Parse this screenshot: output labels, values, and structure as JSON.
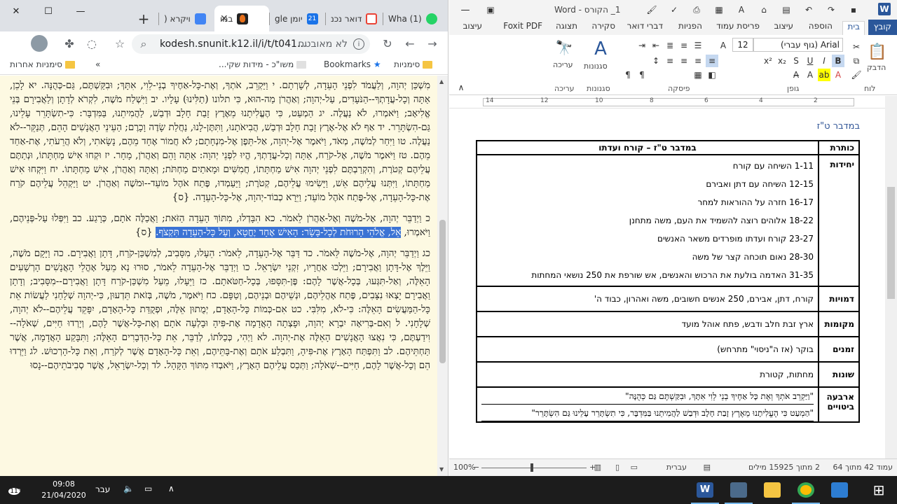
{
  "chrome": {
    "tabs": [
      {
        "label": "במו",
        "active": true,
        "color": "#d93025"
      },
      {
        "label": "ויקרא (",
        "color": "#4285f4"
      },
      {
        "label": "יומן gle",
        "color": "#1a73e8"
      },
      {
        "label": "דואר נכנ",
        "color": "#ea4335"
      },
      {
        "label": "(1) Wha",
        "color": "#25d366"
      }
    ],
    "new_tab_symbol": "+",
    "url": "kodesh.snunit.k12.il/i/t/t041...",
    "security_label": "לא מאובטח",
    "bookmarks": {
      "other": "סימניות אחרות",
      "item1": "משו\"כ - מידות שקי...",
      "item2": "Bookmarks",
      "item3": "סימניות",
      "more": "»"
    },
    "text": {
      "para1": "מִשְׁכַּן יְהוָה, וְלַעֲמֹד לִפְנֵי הָעֵדָה, לְשָׁרְתָם. י וַיַּקְרֵב, אֹתְךָ, וְאֶת-כָּל-אַחֶיךָ בְנֵי-לֵוִי, אִתָּךְ; וּבִקַּשְׁתֶּם, גַּם-כְּהֻנָּה. יא לָכֵן, אַתָּה וְכָל-עֲדָתְךָ--הַנֹּעָדִים, עַל-יְהוָה; וְאַהֲרֹן מַה-הוּא, כִּי תלונו (תַלִּינוּ) עָלָיו. יב וַיִּשְׁלַח מֹשֶׁה, לִקְרֹא לְדָתָן וְלַאֲבִירָם בְּנֵי אֱלִיאָב; וַיֹּאמְרוּ, לֹא נַעֲלֶה. יג הַמְעַט, כִּי הֶעֱלִיתָנוּ מֵאֶרֶץ זָבַת חָלָב וּדְבַשׁ, לַהֲמִיתֵנוּ, בַּמִּדְבָּר: כִּי-תִשְׂתָּרֵר עָלֵינוּ, גַּם-הִשְׂתָּרֵר. יד אַף לֹא אֶל-אֶרֶץ זָבַת חָלָב וּדְבַשׁ, הֲבִיאֹתָנוּ, וַתִּתֶּן-לָנוּ, נַחֲלַת שָׂדֶה וָכָרֶם; הַעֵינֵי הָאֲנָשִׁים הָהֵם, תְּנַקֵּר--לֹא נַעֲלֶה. טו וַיִּחַר לְמֹשֶׁה, מְאֹד, וַיֹּאמֶר אֶל-יְהוָה, אַל-תֵּפֶן אֶל-מִנְחָתָם; לֹא חֲמוֹר אֶחָד מֵהֶם, נָשָׂאתִי, וְלֹא הֲרֵעֹתִי, אֶת-אַחַד מֵהֶם. טז וַיֹּאמֶר מֹשֶׁה, אֶל-קֹרַח, אַתָּה וְכָל-עֲדָתְךָ, הֱיוּ לִפְנֵי יְהוָה: אַתָּה וָהֵם וְאַהֲרֹן, מָחָר. יז וּקְחוּ אִישׁ מַחְתָּתוֹ, וּנְתַתֶּם עֲלֵיהֶם קְטֹרֶת, וְהִקְרַבְתֶּם לִפְנֵי יְהוָה אִישׁ מַחְתָּתוֹ, חֲמִשִּׁים וּמָאתַיִם מַחְתֹּת; וְאַתָּה וְאַהֲרֹן, אִישׁ מַחְתָּתוֹ. יח וַיִּקְחוּ אִישׁ מַחְתָּתוֹ, וַיִּתְּנוּ עֲלֵיהֶם אֵשׁ, וַיָּשִׂימוּ עֲלֵיהֶם, קְטֹרֶת; וַיַּעַמְדוּ, פֶּתַח אֹהֶל מוֹעֵד--וּמֹשֶׁה וְאַהֲרֹן. יט וַיַּקְהֵל עֲלֵיהֶם קֹרַח אֶת-כָּל-הָעֵדָה, אֶל-פֶּתַח אֹהֶל מוֹעֵד; וַיֵּרָא כְבוֹד-יְהוָה, אֶל-כָּל-הָעֵדָה. {ס}",
      "para2_a": "כ וַיְדַבֵּר יְהוָה, אֶל-מֹשֶׁה וְאֶל-אַהֲרֹן לֵאמֹר. כא הִבָּדְלוּ, מִתּוֹךְ הָעֵדָה הַזֹּאת; וַאֲכַלֶּה אֹתָם, כְּרָגַע. כב וַיִּפְּלוּ עַל-פְּנֵיהֶם, וַיֹּאמְרוּ,",
      "para2_hl": "אֵל, אֱלֹהֵי הָרוּחֹת לְכָל-בָּשָׂר: הָאִישׁ אֶחָד יֶחֱטָא, וְעַל כָּל-הָעֵדָה תִּקְצֹף.",
      "para2_b": "{ס}",
      "para3": "כג וַיְדַבֵּר יְהוָה, אֶל-מֹשֶׁה לֵּאמֹר. כד דַּבֵּר אֶל-הָעֵדָה, לֵאמֹר: הֵעָלוּ, מִסָּבִיב, לְמִשְׁכַּן-קֹרַח, דָּתָן וַאֲבִירָם. כה וַיָּקָם מֹשֶׁה, וַיֵּלֶךְ אֶל-דָּתָן וַאֲבִירָם; וַיֵּלְכוּ אַחֲרָיו, זִקְנֵי יִשְׂרָאֵל. כו וַיְדַבֵּר אֶל-הָעֵדָה לֵאמֹר, סוּרוּ נָא מֵעַל אָהֳלֵי הָאֲנָשִׁים הָרְשָׁעִים הָאֵלֶּה, וְאַל-תִּגְּעוּ, בְּכָל-אֲשֶׁר לָהֶם: פֶּן-תִּסָּפוּ, בְּכָל-חַטֹּאתָם. כז וַיֵּעָלוּ, מֵעַל מִשְׁכַּן-קֹרַח דָּתָן וַאֲבִירָם--מִסָּבִיב; וְדָתָן וַאֲבִירָם יָצְאוּ נִצָּבִים, פֶּתַח אָהֳלֵיהֶם, וּנְשֵׁיהֶם וּבְנֵיהֶם, וְטַפָּם. כח וַיֹּאמֶר, מֹשֶׁה, בְּזֹאת תֵּדְעוּן, כִּי-יְהוָה שְׁלָחַנִי לַעֲשׂוֹת אֵת כָּל-הַמַּעֲשִׂים הָאֵלֶּה: כִּי-לֹא, מִלִּבִּי. כט אִם-כְּמוֹת כָּל-הָאָדָם, יְמֻתוּן אֵלֶּה, וּפְקֻדַּת כָּל-הָאָדָם, יִפָּקֵד עֲלֵיהֶם--לֹא יְהוָה, שְׁלָחָנִי. ל וְאִם-בְּרִיאָה יִבְרָא יְהוָה, וּפָצְתָה הָאֲדָמָה אֶת-פִּיהָ וּבָלְעָה אֹתָם וְאֶת-כָּל-אֲשֶׁר לָהֶם, וְיָרְדוּ חַיִּים, שְׁאֹלָה--וִידַעְתֶּם, כִּי נִאֲצוּ הָאֲנָשִׁים הָאֵלֶּה אֶת-יְהוָה. לא וַיְהִי, כְּכַלֹּתוֹ, לְדַבֵּר, אֵת כָּל-הַדְּבָרִים הָאֵלֶּה; וַתִּבָּקַע הָאֲדָמָה, אֲשֶׁר תַּחְתֵּיהֶם. לב וַתִּפְתַּח הָאָרֶץ אֶת-פִּיהָ, וַתִּבְלַע אֹתָם וְאֶת-בָּתֵּיהֶם, וְאֵת כָּל-הָאָדָם אֲשֶׁר לְקֹרַח, וְאֵת כָּל-הָרְכוּשׁ. לג וַיֵּרְדוּ הֵם וְכָל-אֲשֶׁר לָהֶם, חַיִּים--שְׁאֹלָה; וַתְּכַס עֲלֵיהֶם הָאָרֶץ, וַיֹּאבְדוּ מִתּוֹךְ הַקָּהָל. לד וְכָל-יִשְׂרָאֵל, אֲשֶׁר סְבִיבֹתֵיהֶם--נָסוּ"
    }
  },
  "word": {
    "title": "1_ הקורס - Word",
    "tabs": [
      "קובץ",
      "בית",
      "הוספה",
      "עיצוב",
      "פריסת עמוד",
      "הפניות",
      "דברי דואר",
      "סקירה",
      "תצוגה",
      "Foxit PDF",
      "עיצוב"
    ],
    "ribbon": {
      "font_name": "Arial (גוף עברי)",
      "font_size": "12",
      "groups": {
        "clipboard": "לוח",
        "font": "גופן",
        "paragraph": "פיסקה",
        "styles": "סגנונות",
        "editing": "עריכה"
      },
      "paste_label": "הדבק",
      "styles_button": "סגנונות",
      "editing_button": "עריכה"
    },
    "ruler_ticks": [
      "2",
      "4",
      "6",
      "8",
      "10",
      "12",
      "14"
    ],
    "doc_heading": "במדבר ט\"ז",
    "table": {
      "title_header": "כותרת",
      "title_value": "במדבר ט\"ז – קורח ועדתו",
      "units_header": "יחידות",
      "units": [
        "1-11 השיחה עם קורח",
        "12-15 השיחה עם דתן ואבירם",
        "16-17 חזרה על ההוראות למחר",
        "18-22 אלוהים רוצה להשמיד את העם, משה מתחנן",
        "23-27 קורח ועדתו מופרדים משאר האנשים",
        "28-30 נאום תוכחה קצר של משה",
        "31-35 האדמה בולעת את הרכוש והאנשים, אש שורפת את 250 נושאי המחתות"
      ],
      "chars_header": "דמויות",
      "chars_value": "קורח, דתן, אבירם, 250 אנשים חשובים, משה ואהרון, כבוד ה'",
      "places_header": "מקומות",
      "places_value": "ארץ זבת חלב ודבש, פתח אוהל מועד",
      "times_header": "זמנים",
      "times_value": "בוקר (אז ה\"ניסוי\" מתרחש)",
      "misc_header": "שונות",
      "misc_value": "מחתות, קטורת",
      "phrases_header": "ארבעה ביטויים",
      "phrase1": "\"וַיַּקְרֵב אֹתְךָ וְאֶת כָּל אַחֶיךָ בְנֵי לֵוִי אִתָּךְ, וּבִקַּשְׁתֶּם גַּם כְּהֻנָּה\"",
      "phrase2": "\"הַמְעַט כִּי הֶעֱלִיתָנוּ מֵאֶרֶץ זָבַת חָלָב וּדְבַשׁ לַהֲמִיתֵנוּ בַּמִּדְבָּר, כִּי תִשְׂתָּרֵר עָלֵינוּ גַּם הִשְׂתָּרֵר\""
    },
    "status": {
      "page": "עמוד 42 מתוך 64",
      "words": "2 מתוך 15925 מילים",
      "lang": "עברית",
      "zoom": "100%"
    }
  },
  "taskbar": {
    "time": "09:08",
    "date": "21/04/2020",
    "lang": "עבר",
    "notif_count": "11"
  }
}
